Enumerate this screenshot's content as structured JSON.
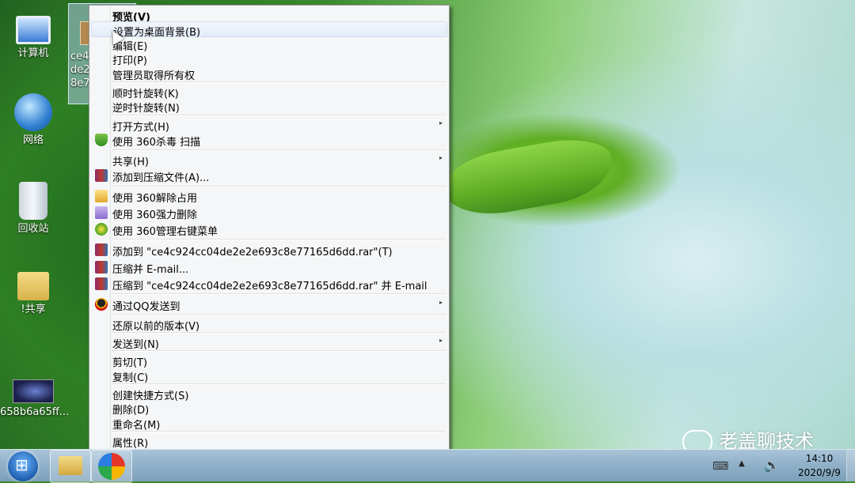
{
  "desktop": {
    "icons": [
      {
        "label": "计算机",
        "icon": "computer-icon"
      },
      {
        "label": "网络",
        "icon": "network-globe-icon"
      },
      {
        "label": "回收站",
        "icon": "recycle-bin-icon"
      },
      {
        "label": "!共享",
        "icon": "shared-folder-icon"
      },
      {
        "label": "658b6a65ff...",
        "icon": "image-file-icon"
      }
    ],
    "selected_file": {
      "name_fragment": "ce4c\nde2\n8e7",
      "icon": "image-thumbnail-icon"
    }
  },
  "context_menu": {
    "items": [
      {
        "label": "预览(V)",
        "bold": true
      },
      {
        "label": "设置为桌面背景(B)",
        "hover": true
      },
      {
        "label": "编辑(E)"
      },
      {
        "label": "打印(P)"
      },
      {
        "label": "管理员取得所有权"
      },
      {
        "label": "顺时针旋转(K)"
      },
      {
        "label": "逆时针旋转(N)"
      },
      {
        "label": "打开方式(H)",
        "submenu": true
      },
      {
        "label": "使用 360杀毒 扫描",
        "icon": "shield-icon"
      },
      {
        "label": "共享(H)",
        "submenu": true
      },
      {
        "label": "添加到压缩文件(A)...",
        "icon": "archive-icon"
      },
      {
        "label": "使用 360解除占用",
        "icon": "unlock-icon"
      },
      {
        "label": "使用 360强力删除",
        "icon": "shred-icon"
      },
      {
        "label": "使用 360管理右键菜单",
        "icon": "plus-icon"
      },
      {
        "label": "添加到 \"ce4c924cc04de2e2e693c8e77165d6dd.rar\"(T)",
        "icon": "archive-icon"
      },
      {
        "label": "压缩并 E-mail...",
        "icon": "archive-icon"
      },
      {
        "label": "压缩到 \"ce4c924cc04de2e2e693c8e77165d6dd.rar\" 并 E-mail",
        "icon": "archive-icon"
      },
      {
        "label": "通过QQ发送到",
        "icon": "qq-penguin-icon",
        "submenu": true
      },
      {
        "label": "还原以前的版本(V)"
      },
      {
        "label": "发送到(N)",
        "submenu": true
      },
      {
        "label": "剪切(T)"
      },
      {
        "label": "复制(C)"
      },
      {
        "label": "创建快捷方式(S)"
      },
      {
        "label": "删除(D)"
      },
      {
        "label": "重命名(M)"
      },
      {
        "label": "属性(R)"
      }
    ],
    "submenu_arrow": "▸"
  },
  "taskbar": {
    "start_icon": "windows-start-orb-icon",
    "pinned": [
      {
        "name": "file-explorer",
        "icon": "folder-icon"
      },
      {
        "name": "browser",
        "icon": "browser-icon"
      }
    ],
    "tray": {
      "keyboard_icon": "⌨",
      "overflow_icon": "▲",
      "volume_icon": "🔈",
      "time": "14:10",
      "date": "2020/9/9"
    }
  },
  "watermark": {
    "text": "老盖聊技术",
    "icon": "wechat-icon"
  }
}
